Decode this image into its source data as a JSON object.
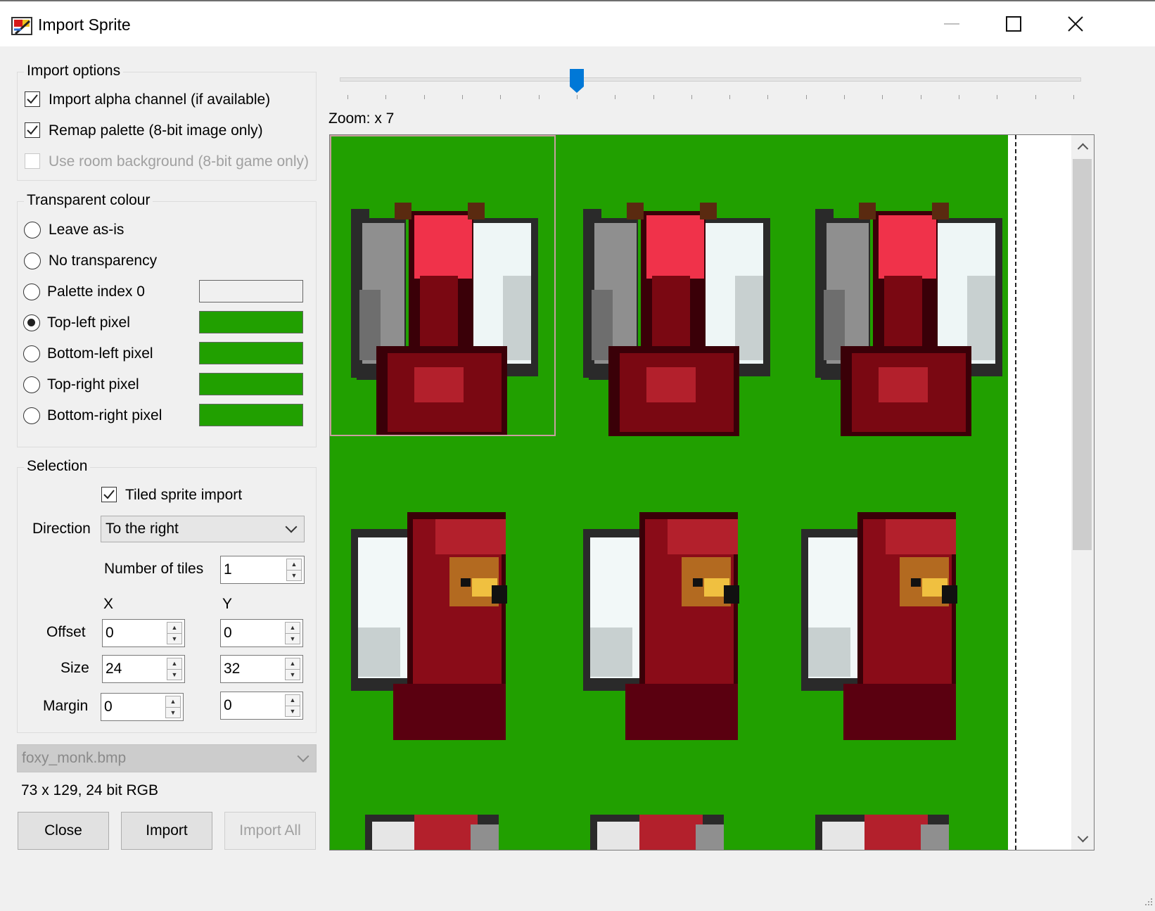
{
  "window": {
    "title": "Import Sprite",
    "icon": "app-sprite-icon",
    "controls": [
      "minimize-icon",
      "maximize-icon",
      "close-icon"
    ]
  },
  "import_options": {
    "title": "Import options",
    "alpha": {
      "label": "Import alpha channel (if available)",
      "checked": true
    },
    "remap": {
      "label": "Remap palette (8-bit image only)",
      "checked": true
    },
    "room_bg": {
      "label": "Use room background (8-bit game only)",
      "checked": false,
      "enabled": false
    }
  },
  "transparent": {
    "title": "Transparent colour",
    "options": [
      {
        "label": "Leave as-is",
        "selected": false
      },
      {
        "label": "No transparency",
        "selected": false
      },
      {
        "label": "Palette index 0",
        "selected": false,
        "swatch": "#f0f0f0"
      },
      {
        "label": "Top-left pixel",
        "selected": true,
        "swatch": "#21a000"
      },
      {
        "label": "Bottom-left pixel",
        "selected": false,
        "swatch": "#21a000"
      },
      {
        "label": "Top-right pixel",
        "selected": false,
        "swatch": "#21a000"
      },
      {
        "label": "Bottom-right pixel",
        "selected": false,
        "swatch": "#21a000"
      }
    ]
  },
  "selection": {
    "title": "Selection",
    "tiled": {
      "label": "Tiled sprite import",
      "checked": true
    },
    "direction_label": "Direction",
    "direction_value": "To the right",
    "num_tiles_label": "Number of tiles",
    "num_tiles": "1",
    "x_header": "X",
    "y_header": "Y",
    "offset_label": "Offset",
    "offset_x": "0",
    "offset_y": "0",
    "size_label": "Size",
    "size_x": "24",
    "size_y": "32",
    "margin_label": "Margin",
    "margin_x": "0",
    "margin_y": "0"
  },
  "file": {
    "name": "foxy_monk.bmp",
    "info": "73 x 129, 24 bit RGB"
  },
  "buttons": {
    "close": "Close",
    "import": "Import",
    "import_all": "Import All"
  },
  "zoom": {
    "label": "Zoom: x 7",
    "value": 7,
    "slider_fraction": 0.31
  },
  "colors": {
    "transparent_key": "#21a000",
    "accent": "#0078d7"
  }
}
